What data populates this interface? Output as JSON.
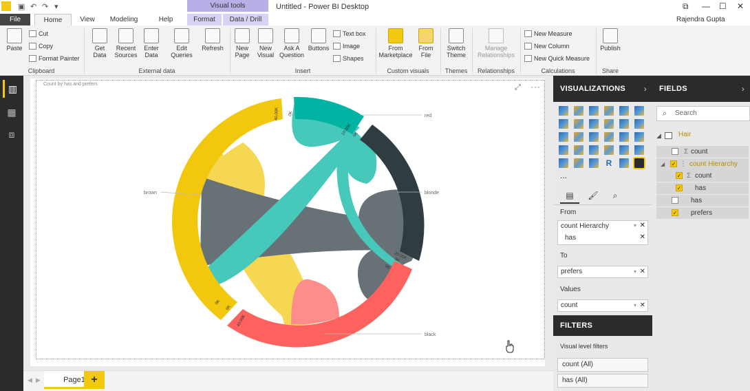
{
  "titlebar": {
    "context_group": "Visual tools",
    "title": "Untitled - Power BI Desktop"
  },
  "user": "Rajendra Gupta",
  "tabs": [
    {
      "label": "File"
    },
    {
      "label": "Home"
    },
    {
      "label": "View"
    },
    {
      "label": "Modeling"
    },
    {
      "label": "Help"
    },
    {
      "label": "Format"
    },
    {
      "label": "Data / Drill"
    }
  ],
  "ribbon": {
    "paste": "Paste",
    "cut": "Cut",
    "copy": "Copy",
    "format_painter": "Format Painter",
    "get_data": "Get Data",
    "recent_sources": "Recent Sources",
    "enter_data": "Enter Data",
    "edit_queries": "Edit Queries",
    "refresh": "Refresh",
    "new_page": "New Page",
    "new_visual": "New Visual",
    "ask_question": "Ask A Question",
    "buttons": "Buttons",
    "text_box": "Text box",
    "image": "Image",
    "shapes": "Shapes",
    "from_marketplace": "From Marketplace",
    "from_file": "From File",
    "switch_theme": "Switch Theme",
    "manage_relationships": "Manage Relationships",
    "new_measure": "New Measure",
    "new_column": "New Column",
    "new_quick_measure": "New Quick Measure",
    "publish": "Publish",
    "groups": {
      "clipboard": "Clipboard",
      "external_data": "External data",
      "insert": "Insert",
      "custom_visuals": "Custom visuals",
      "themes": "Themes",
      "relationships": "Relationships",
      "calculations": "Calculations",
      "share": "Share"
    }
  },
  "visual": {
    "title": "Count by has and prefers"
  },
  "page_tab": "Page1",
  "add_page": "+",
  "visualizations": {
    "header": "VISUALIZATIONS",
    "more": "...",
    "wells": {
      "from_label": "From",
      "from_value": "count Hierarchy",
      "from_sub": "has",
      "to_label": "To",
      "to_value": "prefers",
      "values_label": "Values",
      "values_value": "count"
    },
    "filters_header": "FILTERS",
    "visual_level_filters": "Visual level filters",
    "filter_items": [
      "count (All)",
      "has (All)"
    ]
  },
  "fields": {
    "header": "FIELDS",
    "search_placeholder": "Search",
    "table_name": "Hair",
    "items": [
      {
        "label": "count",
        "checked": false
      },
      {
        "label": "count Hierarchy",
        "checked": true
      },
      {
        "label": "count",
        "checked": true
      },
      {
        "label": "has",
        "checked": true
      },
      {
        "label": "has",
        "checked": false
      },
      {
        "label": "prefers",
        "checked": true
      }
    ]
  },
  "chart_data": {
    "type": "chord",
    "title": "Count by has and prefers",
    "groups": [
      {
        "name": "red",
        "color": "#00b3a2"
      },
      {
        "name": "blonde",
        "color": "#2f3c42"
      },
      {
        "name": "black",
        "color": "#fd625e"
      },
      {
        "name": "brown",
        "color": "#f2c80f"
      }
    ],
    "tick_labels": [
      "0K",
      "40.00K",
      "0K",
      "10.00K",
      "0K",
      "0K",
      "20.00K",
      "0K",
      "0K",
      "40.00K"
    ]
  }
}
